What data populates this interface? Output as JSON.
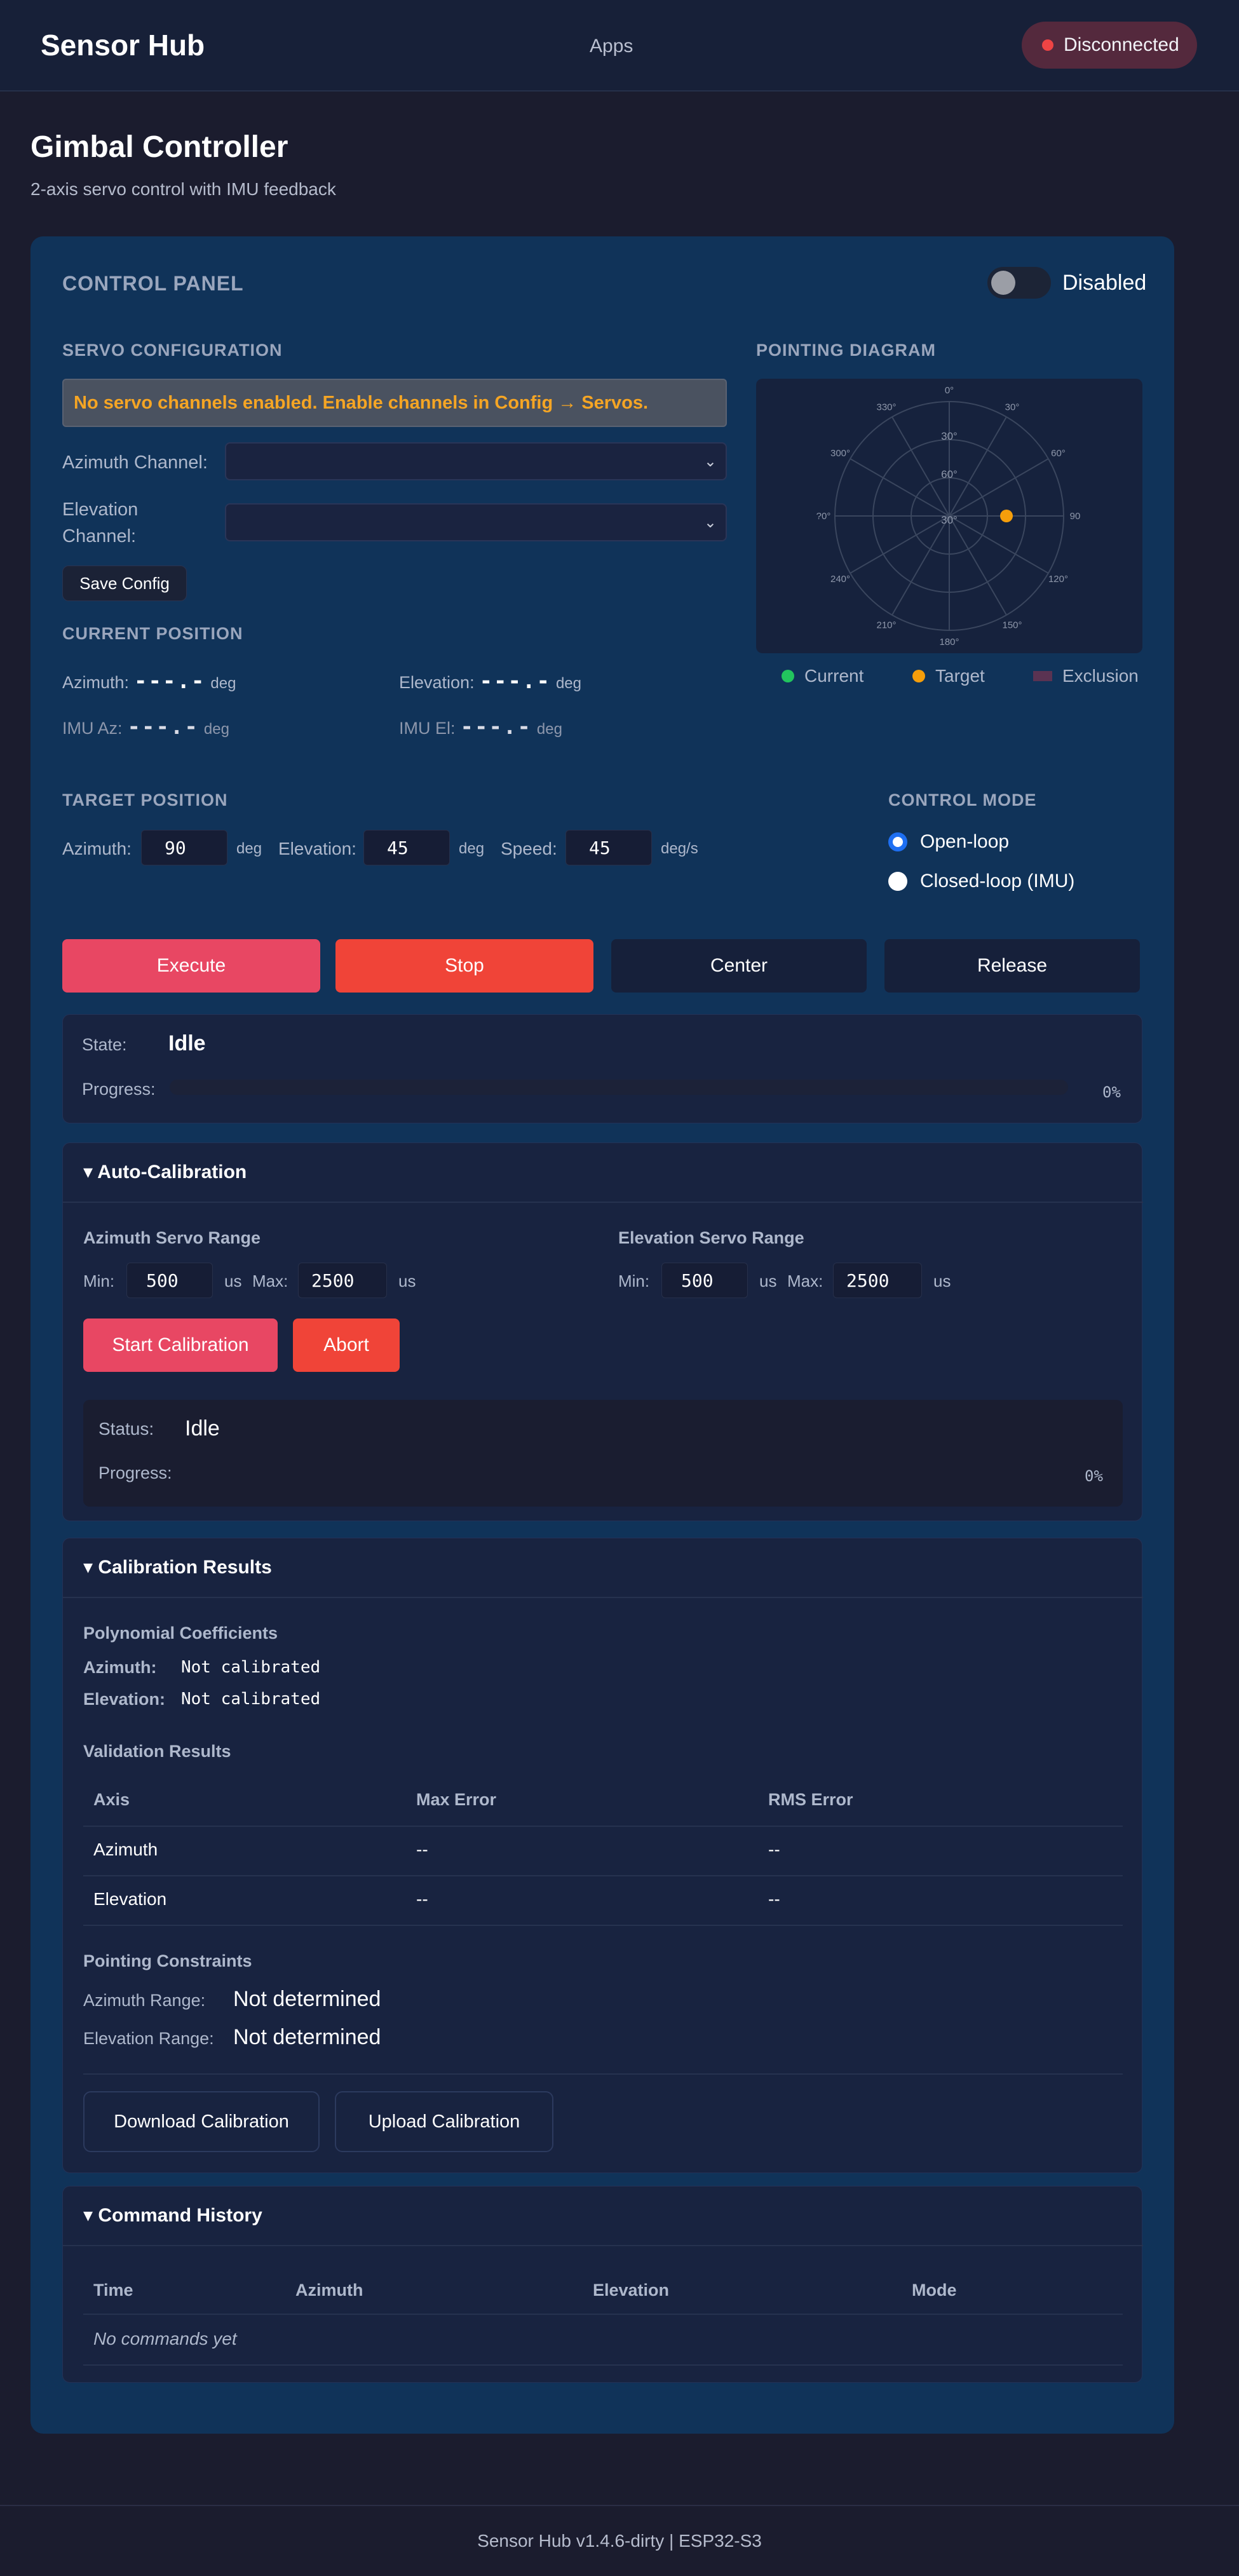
{
  "header": {
    "brand": "Sensor Hub",
    "nav_apps": "Apps",
    "connection_status": "Disconnected"
  },
  "page": {
    "title": "Gimbal Controller",
    "subtitle": "2-axis servo control with IMU feedback"
  },
  "control_panel": {
    "title": "CONTROL PANEL",
    "toggle_label": "Disabled",
    "toggle_on": false
  },
  "servo_config": {
    "title": "SERVO CONFIGURATION",
    "warning": "No servo channels enabled. Enable channels in Config → Servos.",
    "azimuth_label": "Azimuth Channel:",
    "elevation_label_1": "Elevation",
    "elevation_label_2": "Channel:",
    "azimuth_value": "",
    "elevation_value": "",
    "save_label": "Save Config"
  },
  "current_position": {
    "title": "CURRENT POSITION",
    "azimuth_label": "Azimuth:",
    "azimuth_value": "---.-",
    "elevation_label": "Elevation:",
    "elevation_value": "---.-",
    "imu_az_label": "IMU Az:",
    "imu_az_value": "---.-",
    "imu_el_label": "IMU El:",
    "imu_el_value": "---.-",
    "unit": "deg"
  },
  "diagram": {
    "title": "POINTING DIAGRAM",
    "azimuth_labels": [
      "0°",
      "30°",
      "60°",
      "90",
      "120°",
      "150°",
      "180°",
      "210°",
      "240°",
      "?0°",
      "300°",
      "330°"
    ],
    "elevation_labels": [
      "30°",
      "60°",
      "30°"
    ],
    "target": {
      "azimuth_deg": 90,
      "elevation_deg": 45
    },
    "legend": {
      "current": "Current",
      "target": "Target",
      "exclusion": "Exclusion"
    },
    "colors": {
      "current": "#22c55e",
      "target": "#f59e0b",
      "exclusion": "#5a3352"
    }
  },
  "target_position": {
    "title": "TARGET POSITION",
    "azimuth_label": "Azimuth:",
    "azimuth_value": "90",
    "azimuth_unit": "deg",
    "elevation_label": "Elevation:",
    "elevation_value": "45",
    "elevation_unit": "deg",
    "speed_label": "Speed:",
    "speed_value": "45",
    "speed_unit": "deg/s"
  },
  "control_mode": {
    "title": "CONTROL MODE",
    "options": [
      "Open-loop",
      "Closed-loop (IMU)"
    ],
    "selected": "Open-loop"
  },
  "actions": {
    "execute": "Execute",
    "stop": "Stop",
    "center": "Center",
    "release": "Release",
    "colors": {
      "execute": "#e84763",
      "stop": "#f04438",
      "secondary": "#16203a"
    }
  },
  "state_card": {
    "state_label": "State:",
    "state_value": "Idle",
    "progress_label": "Progress:",
    "progress_percent": "0%"
  },
  "auto_calibration": {
    "title": "▾ Auto-Calibration",
    "az_range_title": "Azimuth Servo Range",
    "el_range_title": "Elevation Servo Range",
    "min_label": "Min:",
    "max_label": "Max:",
    "unit": "us",
    "az_min": "500",
    "az_max": "2500",
    "el_min": "500",
    "el_max": "2500",
    "start_label": "Start Calibration",
    "abort_label": "Abort",
    "status_label": "Status:",
    "status_value": "Idle",
    "progress_label": "Progress:",
    "progress_percent": "0%"
  },
  "calibration_results": {
    "title": "▾ Calibration Results",
    "poly_title": "Polynomial Coefficients",
    "az_label": "Azimuth:",
    "az_value": "Not calibrated",
    "el_label": "Elevation:",
    "el_value": "Not calibrated",
    "validation_title": "Validation Results",
    "columns": [
      "Axis",
      "Max Error",
      "RMS Error"
    ],
    "rows": [
      [
        "Azimuth",
        "--",
        "--"
      ],
      [
        "Elevation",
        "--",
        "--"
      ]
    ],
    "constraints_title": "Pointing Constraints",
    "az_range_label": "Azimuth Range:",
    "az_range_value": "Not determined",
    "el_range_label": "Elevation Range:",
    "el_range_value": "Not determined",
    "download_label": "Download Calibration",
    "upload_label": "Upload Calibration"
  },
  "command_history": {
    "title": "▾ Command History",
    "columns": [
      "Time",
      "Azimuth",
      "Elevation",
      "Mode"
    ],
    "empty": "No commands yet"
  },
  "footer": {
    "text": "Sensor Hub v1.4.6-dirty | ESP32-S3"
  }
}
